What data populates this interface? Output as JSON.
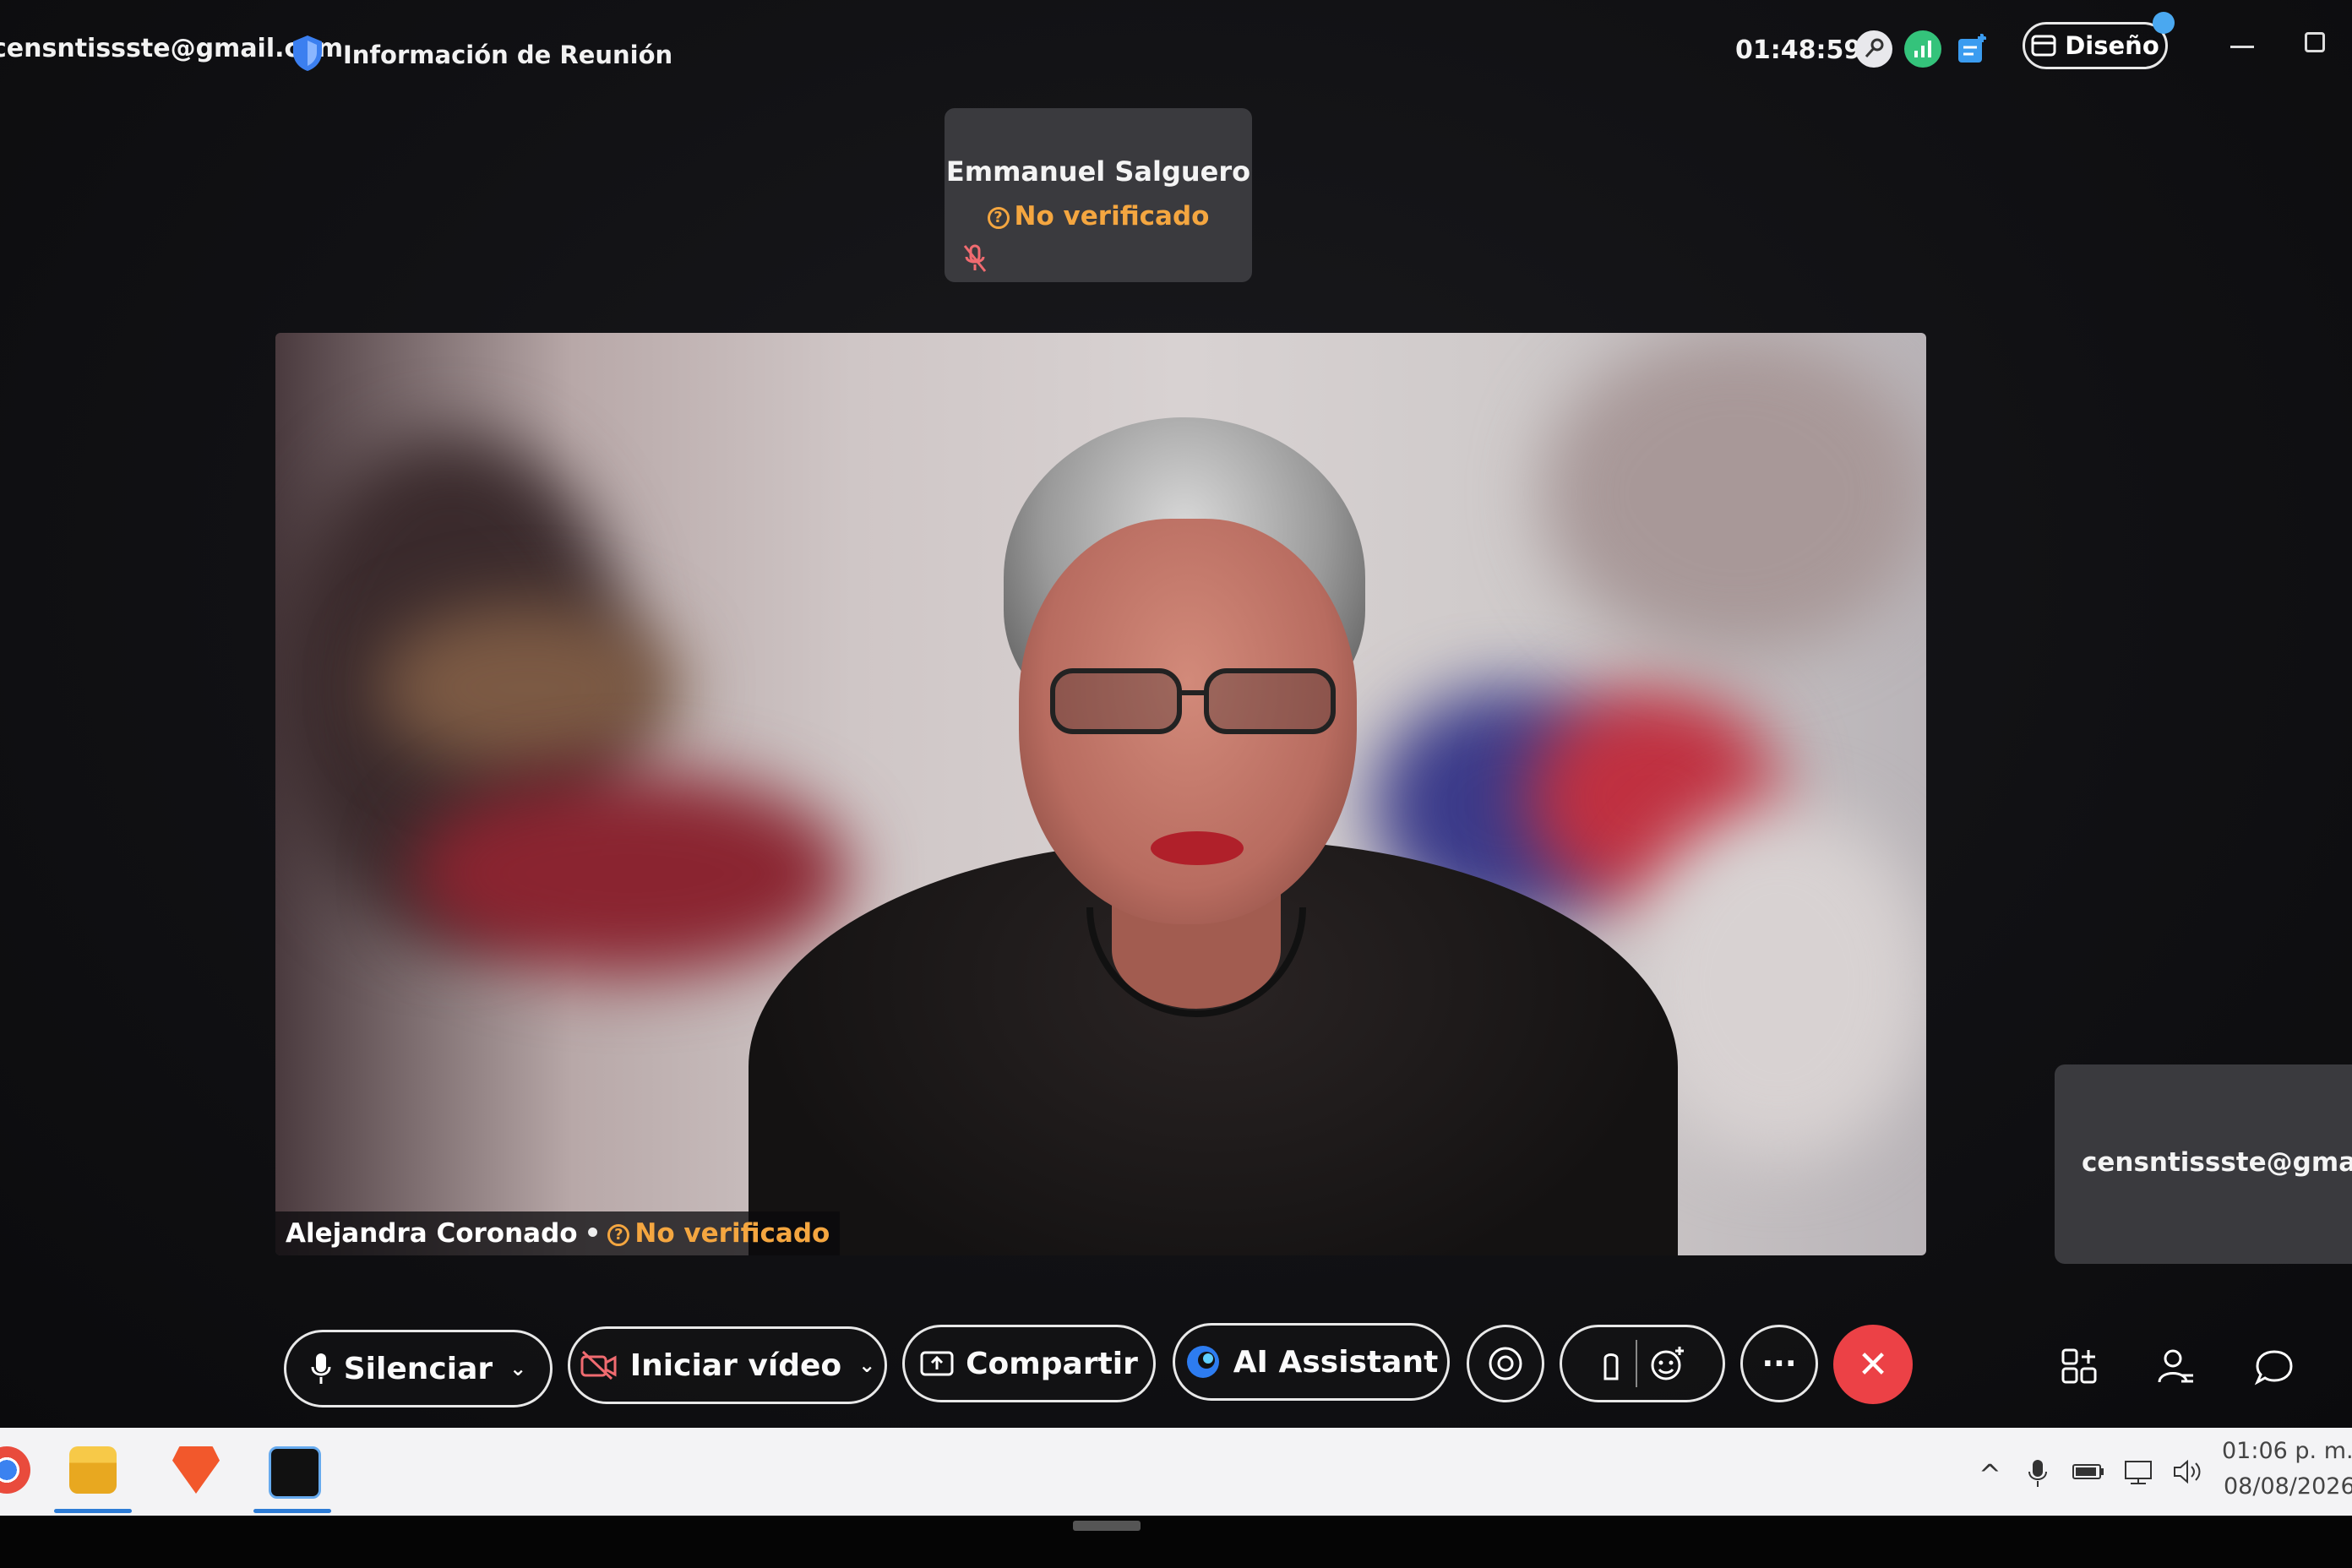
{
  "titlebar": {
    "email": "censntissste@gmail.com",
    "meeting_info": "Información de Reunión",
    "timer": "01:48:59",
    "layout_label": "Diseño"
  },
  "participants": {
    "top": {
      "name": "Emmanuel Salguero",
      "status": "No verificado"
    },
    "main": {
      "name": "Alejandra Coronado",
      "separator": "•",
      "status": "No verificado"
    },
    "right": {
      "name": "censntissste@gmail.com"
    }
  },
  "toolbar": {
    "mute_label": "Silenciar",
    "video_label": "Iniciar vídeo",
    "share_label": "Compartir",
    "ai_label": "AI Assistant",
    "more_label": "···",
    "end_label": "✕"
  },
  "taskbar": {
    "time": "01:06 p. m.",
    "date": "08/08/2026"
  },
  "colors": {
    "status_warning": "#f4a640",
    "end_call": "#ec4146",
    "stats_green": "#34c37b",
    "notification_blue": "#4aa8f0"
  },
  "icons": [
    "shield-icon",
    "key-icon",
    "stats-icon",
    "notes-icon",
    "layout-icon",
    "mic-icon",
    "video-off-icon",
    "share-icon",
    "ai-assistant-icon",
    "record-icon",
    "raise-hand-icon",
    "emoji-reaction-icon",
    "more-icon",
    "end-call-icon",
    "apps-icon",
    "participants-icon",
    "chat-icon",
    "chrome-icon",
    "folder-icon",
    "brave-icon",
    "webex-icon"
  ]
}
